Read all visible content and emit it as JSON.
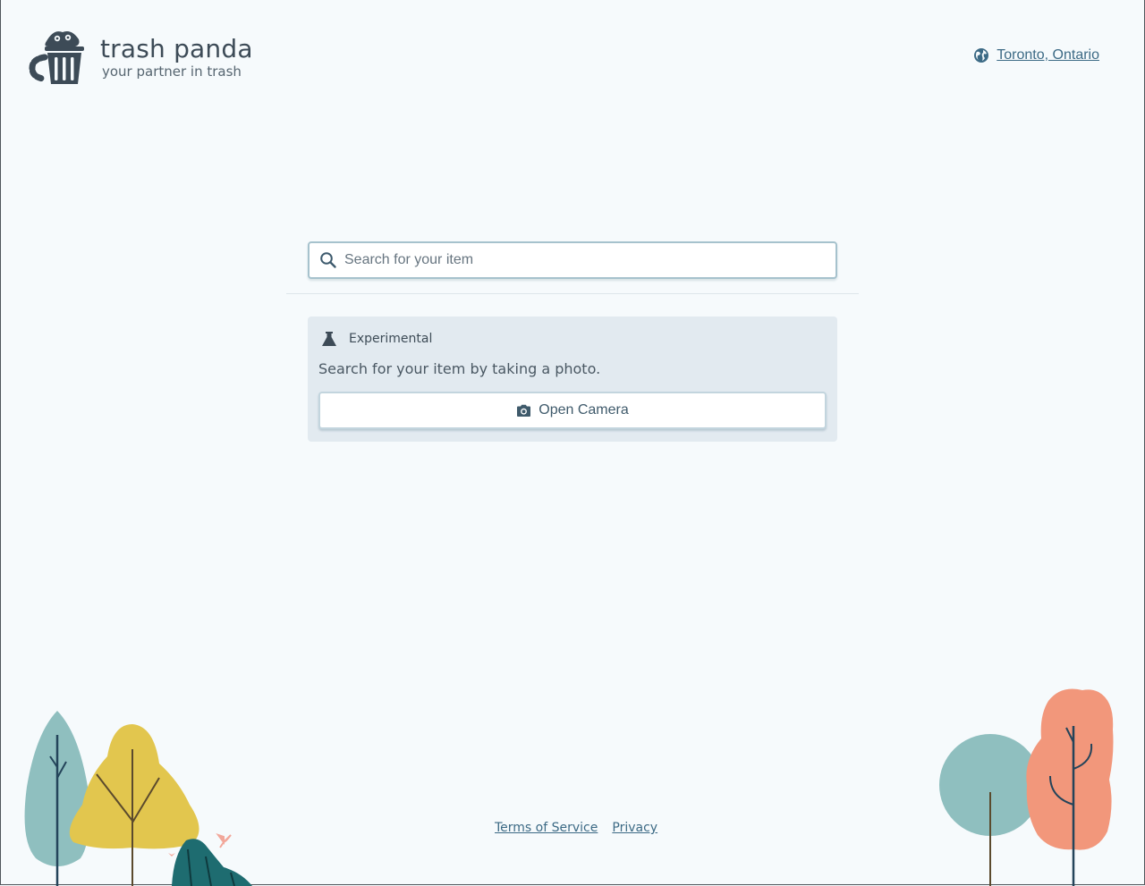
{
  "header": {
    "brand_title": "trash panda",
    "brand_tagline": "your partner in trash",
    "logo_icon": "raccoon-trash-can-icon",
    "location_label": "Toronto, Ontario",
    "location_icon": "globe-icon"
  },
  "search": {
    "placeholder": "Search for your item",
    "value": "",
    "icon": "search-icon"
  },
  "experimental": {
    "title": "Experimental",
    "title_icon": "flask-icon",
    "description": "Search for your item by taking a photo.",
    "button_label": "Open Camera",
    "button_icon": "camera-icon"
  },
  "footer": {
    "terms_label": "Terms of Service",
    "privacy_label": "Privacy"
  },
  "colors": {
    "background": "#f6fafc",
    "text": "#3e4c57",
    "link": "#3c6a85",
    "card": "#e2eaf0",
    "tree_teal": "#8fbfbf",
    "tree_yellow": "#e2c64e",
    "tree_dark_teal": "#1e6c70",
    "tree_salmon": "#f2977b"
  }
}
